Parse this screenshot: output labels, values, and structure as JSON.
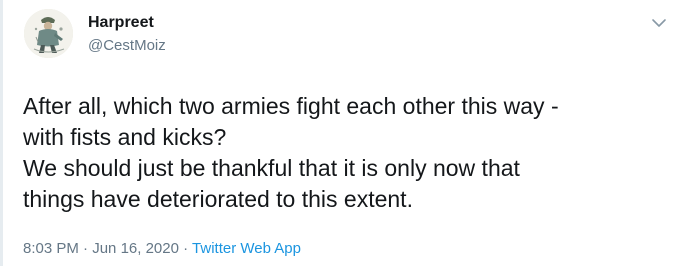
{
  "author": {
    "name": "Harpreet",
    "handle": "@CestMoiz"
  },
  "tweet": {
    "lines": [
      "After all, which two armies fight each other this way -",
      "with fists and kicks?",
      "We should just be thankful that it is only now that",
      "things have deteriorated to this extent."
    ]
  },
  "meta": {
    "time": "8:03 PM",
    "separator": " · ",
    "date": "Jun 16, 2020",
    "source": "Twitter Web App"
  },
  "icons": {
    "caret": "chevron-down-icon",
    "avatar": "avatar-illustration"
  },
  "colors": {
    "text": "#14171a",
    "secondary": "#657786",
    "link": "#1b95e0"
  }
}
